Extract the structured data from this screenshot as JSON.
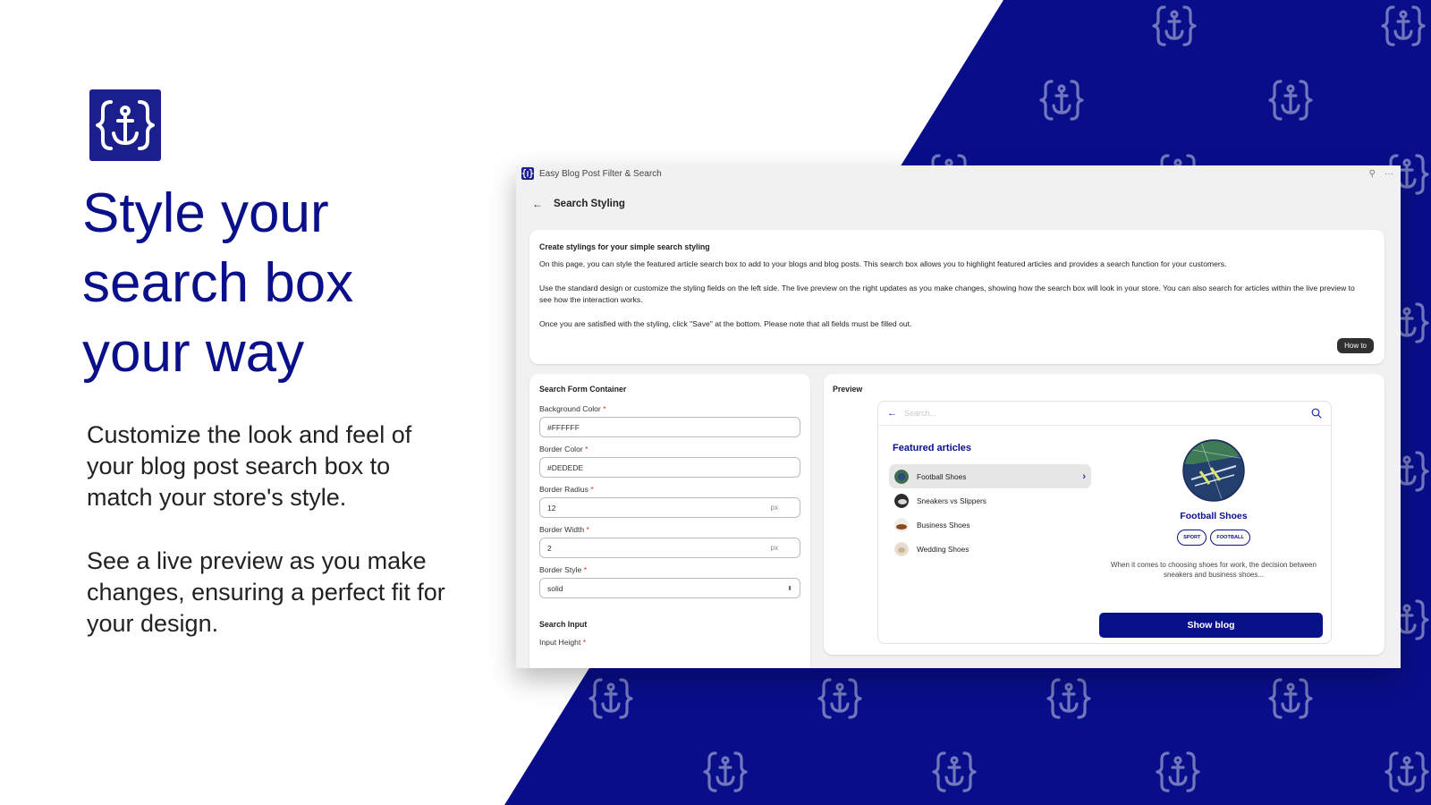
{
  "colors": {
    "brand_navy": "#0a0f8a",
    "pattern_blue": "#0a0f8a",
    "logo_bg": "#1b1f8e",
    "button_navy": "#08108a",
    "required_red": "#d72c0d"
  },
  "icons": {
    "brand": "anchor-braces-logo",
    "back": "arrow-left-icon",
    "search": "magnifier-icon",
    "chevron": "chevron-right-icon"
  },
  "marketing": {
    "headline": "Style your search box your way",
    "paragraph_1": "Customize the look and feel of your blog post search box to match your store's style.",
    "paragraph_2": "See a live preview as you make changes, ensuring a perfect fit for your design."
  },
  "app": {
    "title": "Easy Blog Post Filter & Search",
    "pin_glyph": "⚲",
    "more_glyph": "···",
    "page_title": "Search Styling",
    "back_glyph": "←"
  },
  "info": {
    "heading": "Create stylings for your simple search styling",
    "p1": "On this page, you can style the featured article search box to add to your blogs and blog posts. This search box allows you to highlight featured articles and provides a search function for your customers.",
    "p2": "Use the standard design or customize the styling fields on the left side. The live preview on the right updates as you make changes, showing how the search box will look in your store. You can also search for articles within the live preview to see how the interaction works.",
    "p3": "Once you are satisfied with the styling, click \"Save\" at the bottom. Please note that all fields must be filled out.",
    "howto_label": "How to"
  },
  "form": {
    "heading": "Search Form Container",
    "required_mark": "*",
    "background_color": {
      "label": "Background Color",
      "value": "#FFFFFF"
    },
    "border_color": {
      "label": "Border Color",
      "value": "#DEDEDE"
    },
    "border_radius": {
      "label": "Border Radius",
      "value": "12",
      "suffix": "px"
    },
    "border_width": {
      "label": "Border Width",
      "value": "2",
      "suffix": "px"
    },
    "border_style": {
      "label": "Border Style",
      "value": "solid",
      "arrows": "⬍"
    },
    "search_input_heading": "Search Input",
    "input_height_label": "Input Height"
  },
  "preview": {
    "heading": "Preview",
    "search_placeholder": "Search...",
    "back_glyph": "←",
    "featured_heading": "Featured articles",
    "chevron_glyph": "›",
    "articles": [
      {
        "label": "Football Shoes"
      },
      {
        "label": "Sneakers vs Slippers"
      },
      {
        "label": "Business Shoes"
      },
      {
        "label": "Wedding Shoes"
      }
    ],
    "detail": {
      "title": "Football Shoes",
      "tags": [
        "SPORT",
        "FOOTBALL"
      ],
      "excerpt": "When it comes to choosing shoes for work, the decision between sneakers and business shoes...",
      "button_label": "Show blog"
    }
  }
}
